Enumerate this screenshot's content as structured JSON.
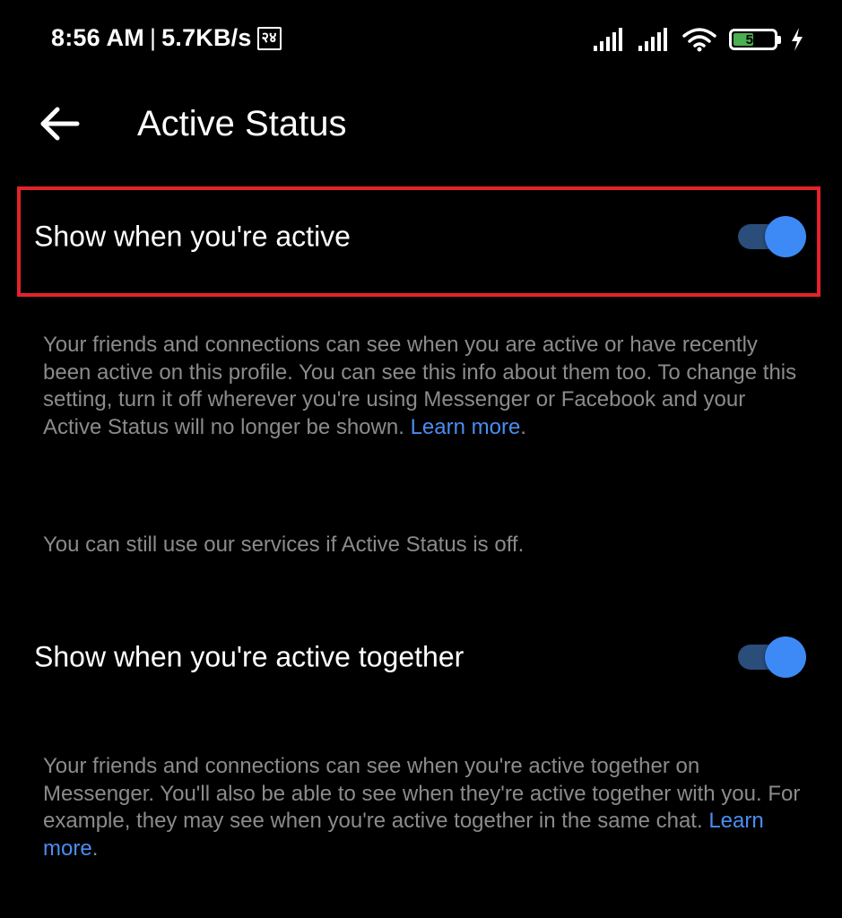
{
  "status_bar": {
    "time": "8:56 AM",
    "separator": "|",
    "speed": "5.7KB/s",
    "notification_glyph": "२४",
    "battery_level": "51",
    "battery_fraction": 0.51,
    "icons": [
      "signal-icon",
      "signal-icon",
      "wifi-icon",
      "battery-icon",
      "charging-icon"
    ]
  },
  "app_bar": {
    "back_icon": "arrow-left-icon",
    "title": "Active Status"
  },
  "settings": {
    "active": {
      "label": "Show when you're active",
      "enabled": true,
      "description": "Your friends and connections can see when you are active or have recently been active on this profile. You can see this info about them too. To change this setting, turn it off wherever you're using Messenger or Facebook and your Active Status will no longer be shown.",
      "learn_more": "Learn more",
      "trailing": "."
    },
    "note": "You can still use our services if Active Status is off.",
    "together": {
      "label": "Show when you're active together",
      "enabled": true,
      "description": "Your friends and connections can see when you're active together on Messenger. You'll also be able to see when they're active together with you. For example, they may see when you're active together in the same chat.",
      "learn_more": "Learn more",
      "trailing": "."
    }
  },
  "colors": {
    "background": "#000000",
    "highlight": "#e2232a",
    "toggle_thumb": "#3d8af7",
    "toggle_track": "#2a4d7a",
    "link": "#4a8df0",
    "secondary_text": "#8b8b8b"
  }
}
